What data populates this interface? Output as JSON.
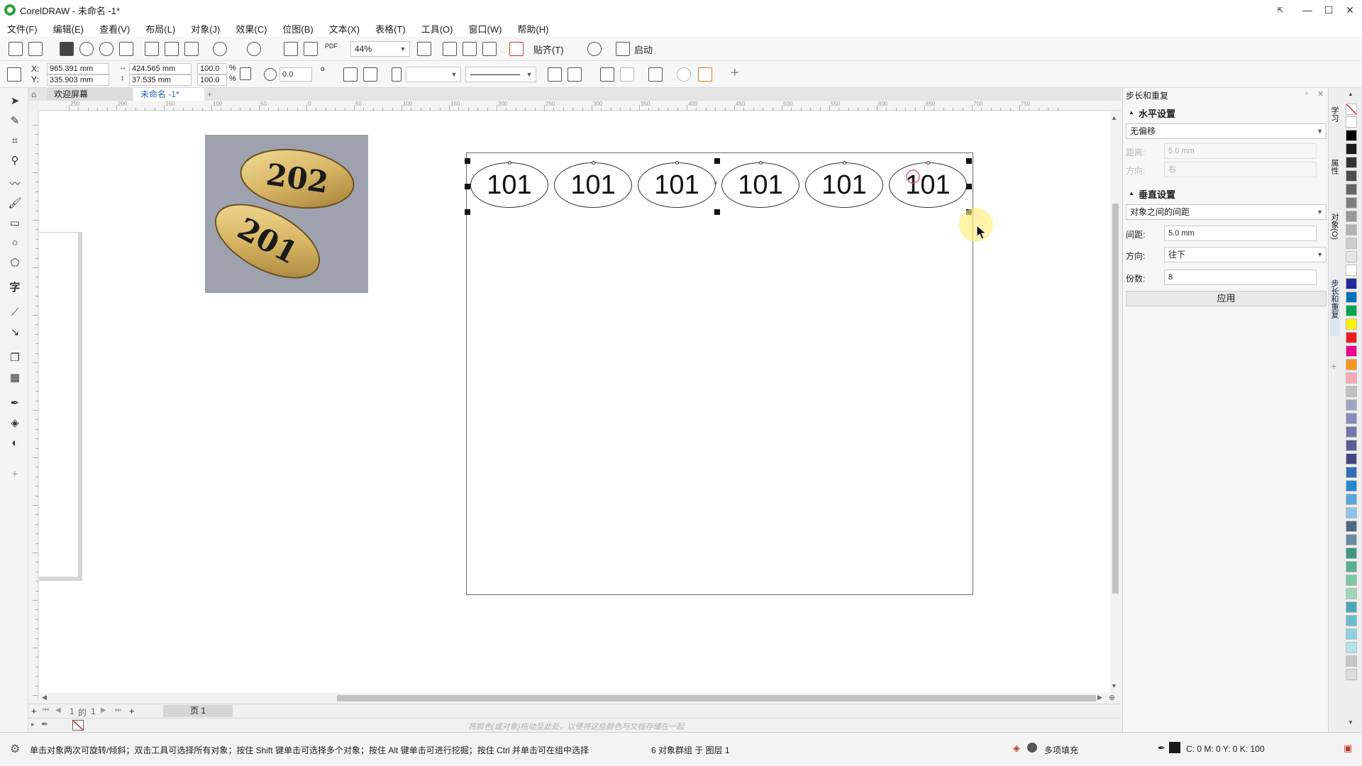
{
  "window": {
    "title": "CorelDRAW - 未命名 -1*"
  },
  "menu": [
    "文件(F)",
    "编辑(E)",
    "查看(V)",
    "布局(L)",
    "对象(J)",
    "效果(C)",
    "位图(B)",
    "文本(X)",
    "表格(T)",
    "工具(O)",
    "窗口(W)",
    "帮助(H)"
  ],
  "toolbar": {
    "zoom": "44%",
    "snap_label": "贴齐(T)",
    "launch_label": "启动",
    "pdf_label": "PDF"
  },
  "property_bar": {
    "x_label": "X:",
    "y_label": "Y:",
    "x": "965.391 mm",
    "y": "335.903 mm",
    "width": "424.565 mm",
    "height": "37.535 mm",
    "scale_w": "100.0",
    "scale_h": "100.0",
    "percent": "%",
    "rotation": "0.0",
    "degree": "o"
  },
  "doc_tabs": [
    "欢迎屏幕",
    "未命名 -1*"
  ],
  "ruler": {
    "h_labels": [
      "250",
      "200",
      "150",
      "100",
      "50",
      "0",
      "50",
      "100",
      "150",
      "200",
      "250",
      "300",
      "350",
      "400",
      "450",
      "500",
      "550",
      "600",
      "650",
      "700",
      "750"
    ]
  },
  "canvas": {
    "oval_text": "101",
    "ref_top": "202",
    "ref_bottom": "201"
  },
  "page_nav": {
    "current": "1",
    "of": "的",
    "total": "1",
    "page_tab": "页 1"
  },
  "color_bar": {
    "hint": "将颜色(或对象)拖动至此处，以便将这些颜色与文档存储在一起"
  },
  "status": {
    "hint": "单击对象两次可旋转/倾斜；双击工具可选择所有对象；按住 Shift 键单击可选择多个对象；按住 Alt 键单击可进行挖掘；按住 Ctrl 并单击可在组中选择",
    "selection": "6 对象群组 于 图层 1",
    "fill": "多项填充",
    "outline": "C: 0 M: 0 Y: 0 K: 100"
  },
  "docker": {
    "title": "步长和重复",
    "horizontal_title": "水平设置",
    "horizontal_mode": "无偏移",
    "h_distance_label": "距离:",
    "h_distance": "5.0 mm",
    "h_direction_label": "方向:",
    "h_direction": "右",
    "vertical_title": "垂直设置",
    "vertical_mode": "对象之间的间距",
    "v_distance_label": "间距:",
    "v_distance": "5.0 mm",
    "v_direction_label": "方向:",
    "v_direction": "往下",
    "copies_label": "份数:",
    "copies": "8",
    "apply": "应用"
  },
  "side_tabs": [
    "学习",
    "属性",
    "对象(O)",
    "步长和重复"
  ],
  "palette_colors": [
    "#ffffff",
    "#000000",
    "#1a1a1a",
    "#333333",
    "#4d4d4d",
    "#666666",
    "#808080",
    "#999999",
    "#b3b3b3",
    "#cccccc",
    "#e6e6e6",
    "#ffffff",
    "#1f2a9c",
    "#0072bc",
    "#00a651",
    "#fff200",
    "#ed1c24",
    "#ec008c",
    "#f7941d",
    "#f9a9b2",
    "#c0c0c0",
    "#a3a3c2",
    "#8b8bc0",
    "#7373ad",
    "#5c5c99",
    "#464685",
    "#2f6fb6",
    "#1f89d0",
    "#5aa6de",
    "#8fc1e8",
    "#4d6b86",
    "#6a8aa3",
    "#3d9a7c",
    "#59b08f",
    "#7bc5a6",
    "#9ed6bc",
    "#4aa6b8",
    "#6bbccc",
    "#8ed1df",
    "#b2e3ec",
    "#c7c7c7",
    "#dcdcdc"
  ]
}
